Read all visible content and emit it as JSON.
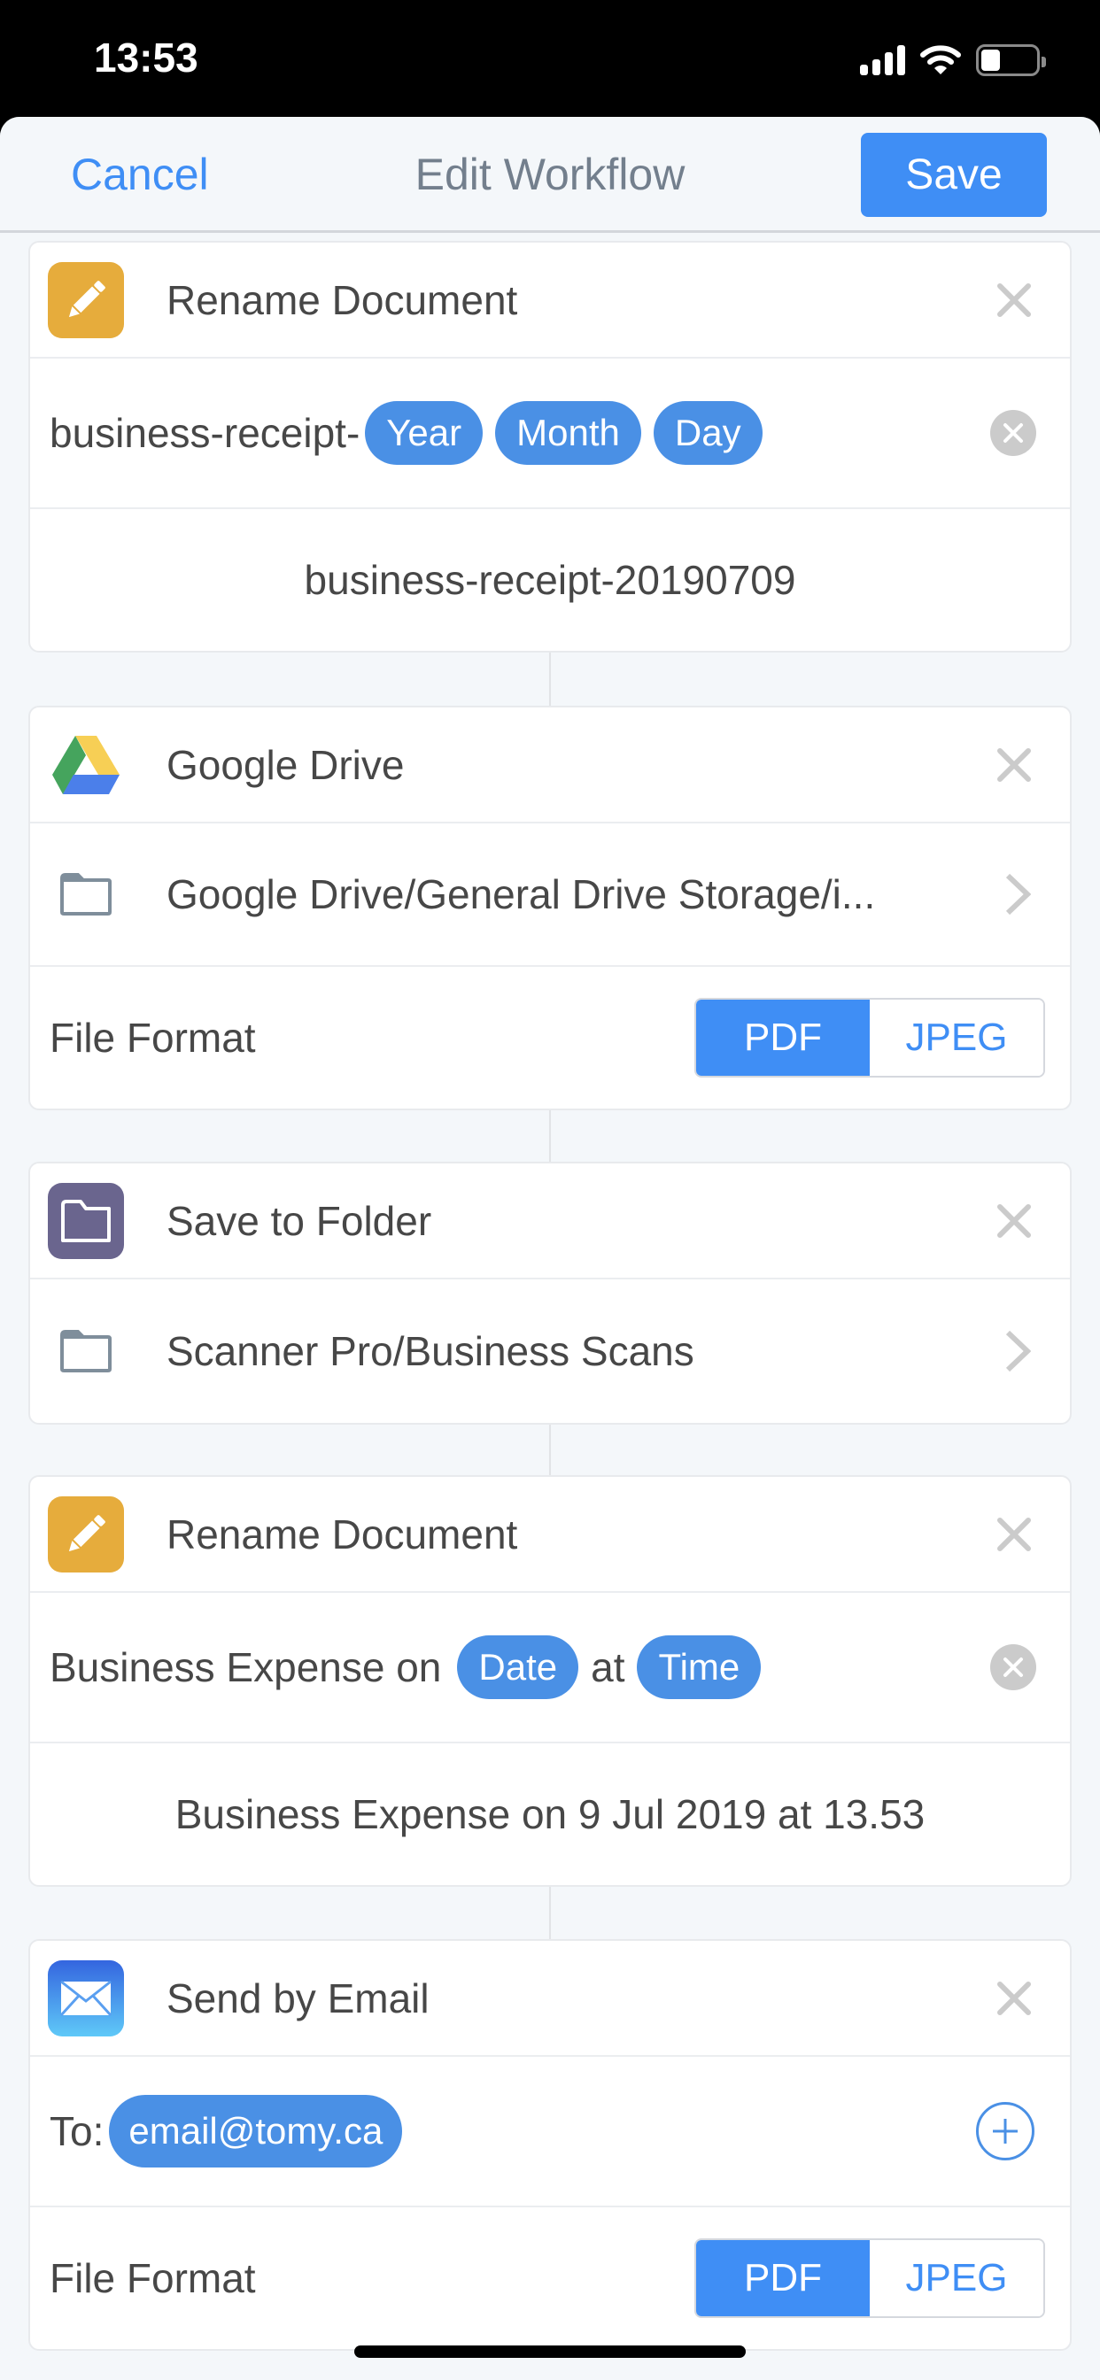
{
  "status_bar": {
    "time": "13:53",
    "icons": [
      "cellular-signal-icon",
      "wifi-icon",
      "battery-icon"
    ],
    "battery_level_percent": 35
  },
  "nav": {
    "cancel_label": "Cancel",
    "title": "Edit Workflow",
    "save_label": "Save"
  },
  "colors": {
    "accent": "#3f8ef5",
    "token": "#4a90e5",
    "rename_icon_bg": "#e6ac3c",
    "folder_icon_bg": "#6a658e",
    "background": "#f4f7fa"
  },
  "steps": [
    {
      "type": "rename",
      "title": "Rename Document",
      "icon": "pencil-icon",
      "pattern": {
        "prefix": "business-receipt-",
        "tokens": [
          "Year",
          "Month",
          "Day"
        ]
      },
      "preview": "business-receipt-20190709"
    },
    {
      "type": "google-drive",
      "title": "Google Drive",
      "icon": "google-drive-icon",
      "folder_path": "Google Drive/General Drive Storage/i...",
      "file_format": {
        "label": "File Format",
        "options": [
          "PDF",
          "JPEG"
        ],
        "selected": "PDF"
      }
    },
    {
      "type": "save-to-folder",
      "title": "Save to Folder",
      "icon": "folder-icon",
      "folder_path": "Scanner Pro/Business Scans"
    },
    {
      "type": "rename",
      "title": "Rename Document",
      "icon": "pencil-icon",
      "pattern": {
        "prefix": "Business Expense on",
        "token1": "Date",
        "middle": "at",
        "token2": "Time"
      },
      "preview": "Business Expense on 9 Jul 2019 at 13.53"
    },
    {
      "type": "email",
      "title": "Send by Email",
      "icon": "mail-icon",
      "to_label": "To:",
      "recipients": [
        "email@tomy.ca"
      ],
      "file_format": {
        "label": "File Format",
        "options": [
          "PDF",
          "JPEG"
        ],
        "selected": "PDF"
      }
    }
  ]
}
